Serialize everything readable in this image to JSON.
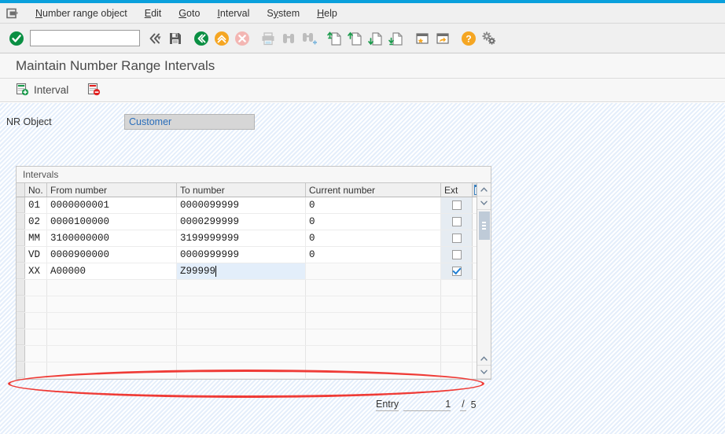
{
  "window": {
    "accent_blue": "#0aa0dc",
    "system_menu_icon": "session-icon"
  },
  "menubar": {
    "items": [
      {
        "label": "Number range object",
        "accel": "N"
      },
      {
        "label": "Edit",
        "accel": "E"
      },
      {
        "label": "Goto",
        "accel": "G"
      },
      {
        "label": "Interval",
        "accel": "I"
      },
      {
        "label": "System",
        "accel": "y"
      },
      {
        "label": "Help",
        "accel": "H"
      }
    ]
  },
  "toolbar": {
    "command_value": "",
    "command_placeholder": "",
    "buttons": [
      {
        "name": "enter-button",
        "icon": "green-check-icon",
        "tooltip": "Enter"
      },
      {
        "name": "back-button",
        "icon": "double-chevron-left-icon",
        "tooltip": "Back"
      },
      {
        "name": "save-button",
        "icon": "save-floppy-icon",
        "tooltip": "Save"
      },
      {
        "name": "exit-button",
        "icon": "green-back-circle-icon",
        "tooltip": "Exit"
      },
      {
        "name": "cancel-button",
        "icon": "yellow-up-circle-icon",
        "tooltip": "Cancel"
      },
      {
        "name": "stop-button",
        "icon": "red-x-circle-icon",
        "tooltip": "Cancel"
      },
      {
        "name": "print-button",
        "icon": "printer-icon",
        "tooltip": "Print"
      },
      {
        "name": "find-button",
        "icon": "binoculars-icon",
        "tooltip": "Find"
      },
      {
        "name": "find-next-button",
        "icon": "binoculars-plus-icon",
        "tooltip": "Find Next"
      },
      {
        "name": "first-page-button",
        "icon": "page-up-first-icon",
        "tooltip": "First Page"
      },
      {
        "name": "previous-page-button",
        "icon": "page-up-icon",
        "tooltip": "Previous Page"
      },
      {
        "name": "next-page-button",
        "icon": "page-down-icon",
        "tooltip": "Next Page"
      },
      {
        "name": "last-page-button",
        "icon": "page-down-last-icon",
        "tooltip": "Last Page"
      },
      {
        "name": "create-shortcut-button",
        "icon": "window-star-icon",
        "tooltip": "Create Shortcut"
      },
      {
        "name": "new-session-button",
        "icon": "window-arrow-icon",
        "tooltip": "Create New Session"
      },
      {
        "name": "help-button",
        "icon": "yellow-question-icon",
        "tooltip": "Help"
      },
      {
        "name": "layout-button",
        "icon": "gears-icon",
        "tooltip": "Customize Local Layout"
      }
    ]
  },
  "title": "Maintain Number Range Intervals",
  "apptoolbar": {
    "interval_label": "Interval",
    "interval_icon": "add-interval-icon",
    "delete_icon": "delete-interval-icon"
  },
  "form": {
    "nr_object_label": "NR Object",
    "nr_object_value": "Customer"
  },
  "intervals": {
    "caption": "Intervals",
    "settings_icon": "table-settings-icon",
    "columns": [
      "No.",
      "From number",
      "To number",
      "Current number",
      "Ext"
    ],
    "rows": [
      {
        "no": "01",
        "from": "0000000001",
        "to": "0000099999",
        "current": "0",
        "ext": false,
        "focused": false,
        "highlighted": false
      },
      {
        "no": "02",
        "from": "0000100000",
        "to": "0000299999",
        "current": "0",
        "ext": false,
        "focused": false,
        "highlighted": false
      },
      {
        "no": "MM",
        "from": "3100000000",
        "to": "3199999999",
        "current": "0",
        "ext": false,
        "focused": false,
        "highlighted": false
      },
      {
        "no": "VD",
        "from": "0000900000",
        "to": "0000999999",
        "current": "0",
        "ext": false,
        "focused": false,
        "highlighted": false
      },
      {
        "no": "XX",
        "from": "A00000",
        "to": "Z99999",
        "current": "",
        "ext": true,
        "focused": true,
        "highlighted": true
      }
    ],
    "empty_row_count": 5,
    "annotation_color": "#ef3b36"
  },
  "footer": {
    "entry_label": "Entry",
    "entry_number": "1",
    "separator": "/",
    "entry_total": "5"
  }
}
